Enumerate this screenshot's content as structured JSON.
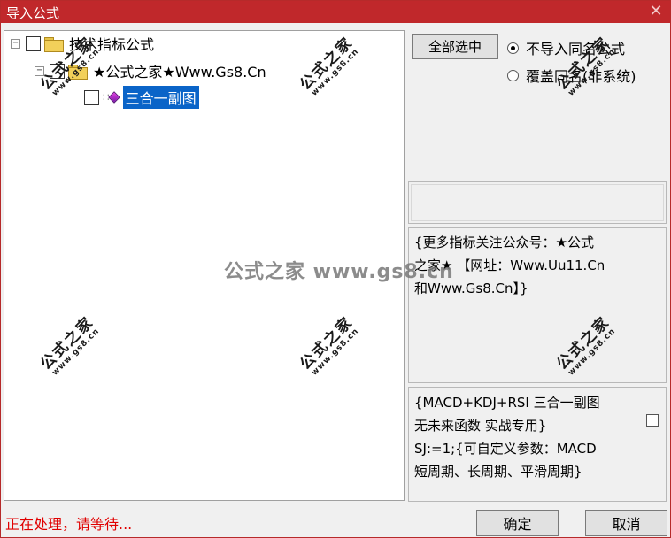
{
  "window": {
    "title": "导入公式",
    "close_symbol": "✕"
  },
  "tree": {
    "root": {
      "expander": "−",
      "label": "技术指标公式"
    },
    "group": {
      "expander": "−",
      "label": "★公式之家★Www.Gs8.Cn"
    },
    "leaf": {
      "label": "三合一副图",
      "selected": true
    }
  },
  "options": {
    "select_all_label": "全部选中",
    "radio_skip_label": "不导入同名公式",
    "radio_overwrite_label": "覆盖同名(非系统)",
    "selected_radio": "skip"
  },
  "info_box": {
    "lines": [
      "{更多指标关注公众号：★公式",
      "之家★ 【网址：Www.Uu11.Cn",
      "和Www.Gs8.Cn】}"
    ]
  },
  "detail_box": {
    "lines": [
      "{MACD+KDJ+RSI 三合一副图",
      "无未来函数 实战专用}",
      "SJ:=1;{可自定义参数：MACD",
      "短周期、长周期、平滑周期}"
    ]
  },
  "status_text": "正在处理，请等待...",
  "buttons": {
    "ok_label": "确定",
    "cancel_label": "取消"
  },
  "watermark": {
    "big": "公式之家",
    "small": "www.gs8.cn",
    "center": "公式之家 www.gs8.cn"
  },
  "colors": {
    "titlebar": "#c0282b",
    "selection": "#0a64c8",
    "status": "#e00000"
  }
}
